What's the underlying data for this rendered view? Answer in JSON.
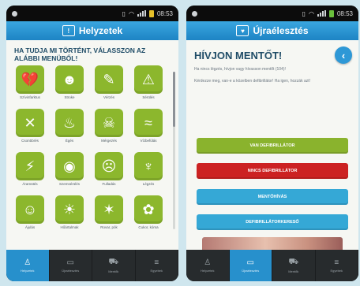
{
  "status_bar": {
    "time_left": "08:53",
    "time_right": "08:53"
  },
  "left_screen": {
    "title": "Helyzetek",
    "title_icon": "warning-icon",
    "prompt": "HA TUDJA MI TÖRTÉNT, VÁLASSZON AZ ALÁBBI MENÜBŐL!",
    "tiles": [
      {
        "label": "Szívinfarktus",
        "icon": "broken-heart-icon",
        "glyph": "💔"
      },
      {
        "label": "Stroke",
        "icon": "head-icon",
        "glyph": "☻"
      },
      {
        "label": "Vérzés",
        "icon": "bleeding-icon",
        "glyph": "✎"
      },
      {
        "label": "Sérülés",
        "icon": "fall-icon",
        "glyph": "⚠"
      },
      {
        "label": "Csonttörés",
        "icon": "bone-icon",
        "glyph": "✕"
      },
      {
        "label": "Égés",
        "icon": "fire-icon",
        "glyph": "♨"
      },
      {
        "label": "Mérgezés",
        "icon": "skull-icon",
        "glyph": "☠"
      },
      {
        "label": "Vízbefúlás",
        "icon": "drowning-icon",
        "glyph": "≈"
      },
      {
        "label": "Áramütés",
        "icon": "electric-icon",
        "glyph": "⚡"
      },
      {
        "label": "Szemsérülés",
        "icon": "eye-icon",
        "glyph": "◉"
      },
      {
        "label": "Fulladás",
        "icon": "choking-icon",
        "glyph": "☹"
      },
      {
        "label": "Légzés",
        "icon": "lungs-icon",
        "glyph": "♆"
      },
      {
        "label": "Ájulás",
        "icon": "fainting-icon",
        "glyph": "☺"
      },
      {
        "label": "Hőártalmak",
        "icon": "sun-icon",
        "glyph": "☀"
      },
      {
        "label": "Rovar, pók",
        "icon": "insect-icon",
        "glyph": "✶"
      },
      {
        "label": "Cukor, kóma",
        "icon": "sugar-icon",
        "glyph": "✿"
      }
    ]
  },
  "right_screen": {
    "title": "Újraélesztés",
    "title_icon": "heart-monitor-icon",
    "heading": "HÍVJON MENTŐT!",
    "paragraph1": "Ha nincs légzés, hívjon vagy hívasson mentőt (104)!",
    "paragraph2": "Kérdezze meg, van-e a közelben defibrillátor! Ha igen, hozzák azt!",
    "buttons": [
      {
        "label": "VAN DEFIBRILLÁTOR",
        "color": "#8ab32d"
      },
      {
        "label": "NINCS DEFIBRILLÁTOR",
        "color": "#cc2222"
      },
      {
        "label": "MENTŐHÍVÁS",
        "color": "#35a8d6"
      },
      {
        "label": "DEFIBRILLÁTORKERESŐ",
        "color": "#35a8d6"
      }
    ]
  },
  "nav": {
    "left_items": [
      {
        "label": "Helyzetek",
        "icon": "person-icon"
      },
      {
        "label": "Újraélesztés",
        "icon": "monitor-icon"
      },
      {
        "label": "Mentők",
        "icon": "ambulance-icon"
      },
      {
        "label": "Egyebek",
        "icon": "menu-icon"
      }
    ],
    "right_items": [
      {
        "label": "Helyzetek",
        "icon": "person-icon"
      },
      {
        "label": "Újraélesztés",
        "icon": "monitor-icon"
      },
      {
        "label": "Mentők",
        "icon": "ambulance-icon"
      },
      {
        "label": "Egyebek",
        "icon": "menu-icon"
      }
    ]
  },
  "colors": {
    "background": "#cfe6ee",
    "header_blue": "#2790cc",
    "tile_green": "#8cb72d",
    "heading_navy": "#1f4c67"
  }
}
